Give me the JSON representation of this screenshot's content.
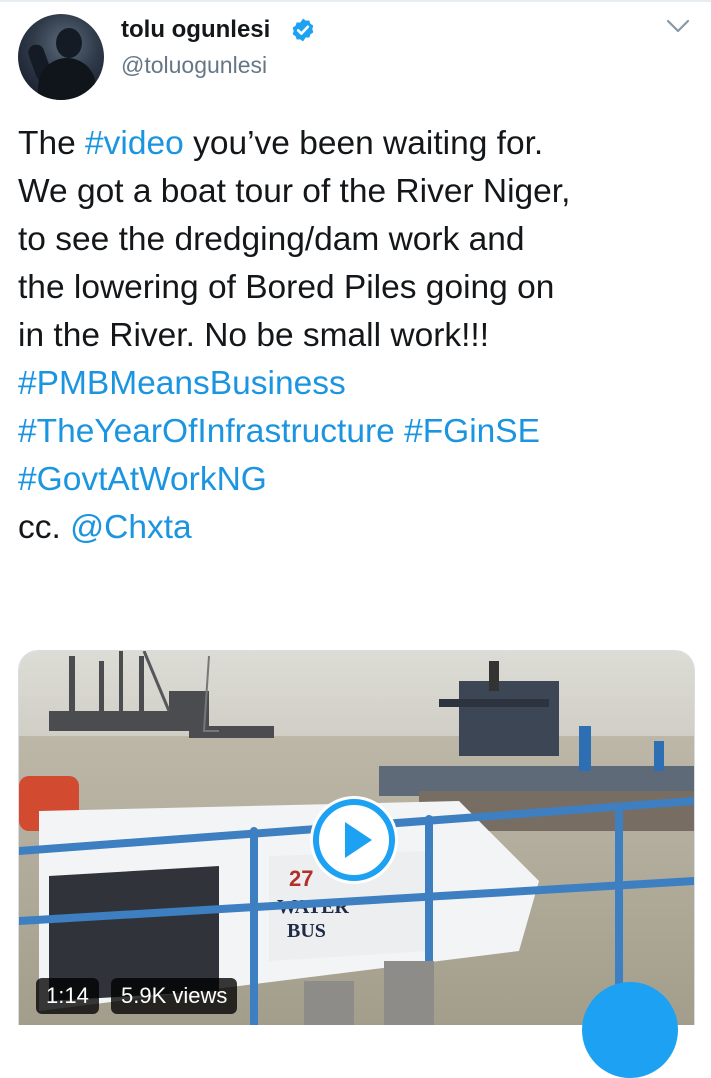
{
  "tweet": {
    "author_name": "tolu ogunlesi",
    "author_handle": "@toluogunlesi",
    "lines": [
      [
        {
          "t": "The "
        },
        {
          "t": "#video",
          "link": true
        },
        {
          "t": " you’ve been waiting for."
        }
      ],
      [
        {
          "t": "We got a boat tour of the River Niger,"
        }
      ],
      [
        {
          "t": "to see the dredging/dam work and"
        }
      ],
      [
        {
          "t": "the lowering of Bored Piles going on"
        }
      ],
      [
        {
          "t": "in the River. No be small work!!!"
        }
      ],
      [
        {
          "t": "#PMBMeansBusiness",
          "link": true
        }
      ],
      [
        {
          "t": "#TheYearOfInfrastructure",
          "link": true
        },
        {
          "t": " "
        },
        {
          "t": "#FGinSE",
          "link": true
        }
      ],
      [
        {
          "t": "#GovtAtWorkNG",
          "link": true
        }
      ],
      [
        {
          "t": "cc. "
        },
        {
          "t": "@Chxta",
          "link": true
        }
      ]
    ]
  },
  "video": {
    "duration": "1:14",
    "views": "5.9K views",
    "boat_text": [
      "27",
      "WATER",
      "BUS"
    ]
  },
  "icons": {
    "verified": "verified-badge-icon",
    "chevron": "chevron-down-icon",
    "play": "play-icon"
  },
  "colors": {
    "link": "#1b95e0",
    "verified": "#1da1f2",
    "play_ring": "#1da1f2"
  }
}
